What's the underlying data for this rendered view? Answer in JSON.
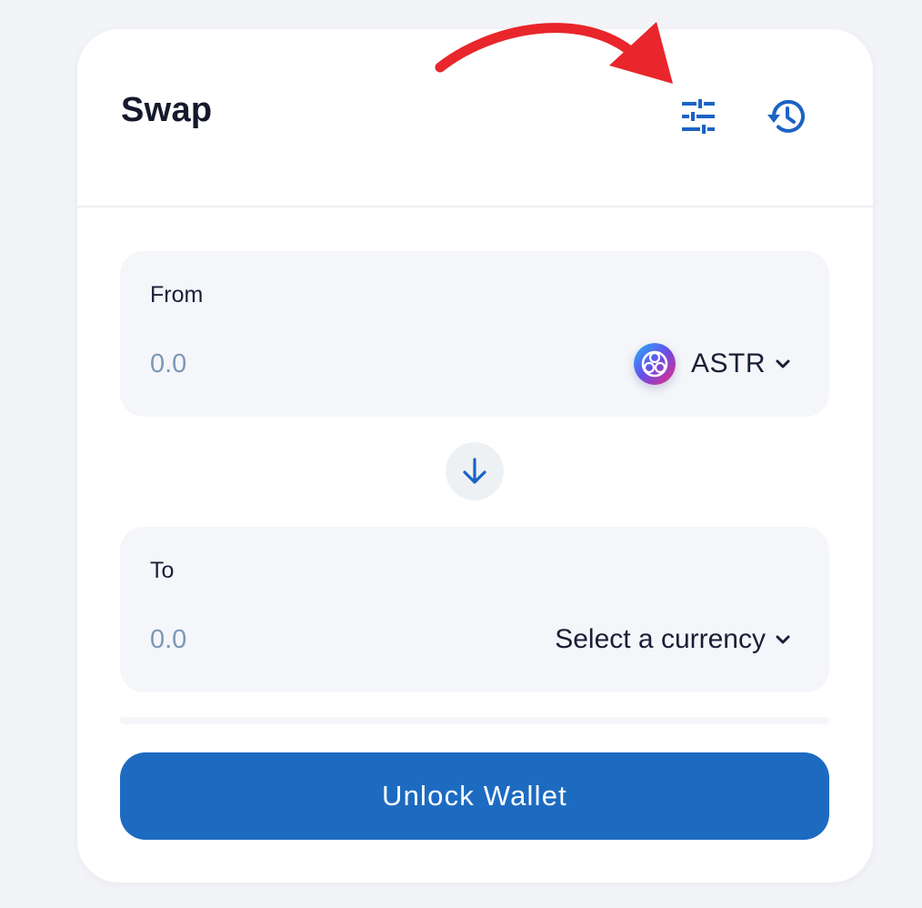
{
  "header": {
    "title": "Swap",
    "settings_icon": "sliders-icon",
    "history_icon": "history-icon"
  },
  "from": {
    "label": "From",
    "amount_placeholder": "0.0",
    "token_symbol": "ASTR",
    "token_icon": "astr-token-logo"
  },
  "switch_icon": "arrow-down-icon",
  "to": {
    "label": "To",
    "amount_placeholder": "0.0",
    "currency_placeholder": "Select a currency"
  },
  "action": {
    "unlock_label": "Unlock Wallet"
  },
  "colors": {
    "primary": "#1d6bc1",
    "icon_blue": "#1b63c4",
    "placeholder": "#7b98b8",
    "annotation_arrow": "#e8262b",
    "panel_bg": "#f5f6fa",
    "page_bg": "#f3f4f8"
  }
}
